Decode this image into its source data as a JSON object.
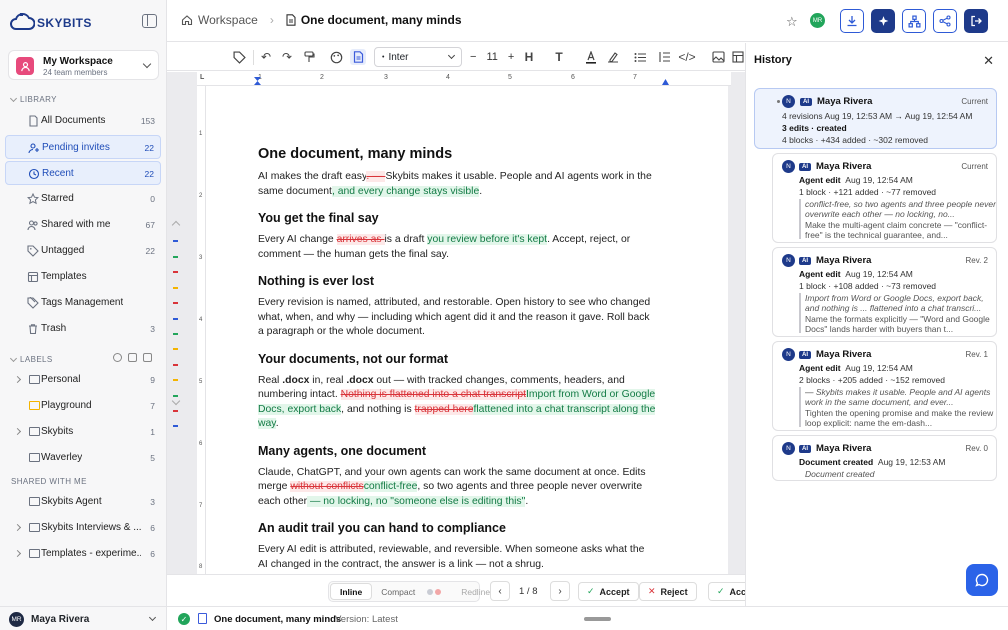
{
  "brand": {
    "name": "SKYBITS"
  },
  "workspace": {
    "name": "My Workspace",
    "members": "24 team members"
  },
  "sidebar": {
    "library_label": "LIBRARY",
    "library": [
      {
        "label": "All Documents",
        "count": "153"
      },
      {
        "label": "Pending invites",
        "count": "22"
      },
      {
        "label": "Recent",
        "count": "22"
      },
      {
        "label": "Starred",
        "count": "0"
      },
      {
        "label": "Shared with me",
        "count": "67"
      },
      {
        "label": "Untagged",
        "count": "22"
      },
      {
        "label": "Templates",
        "count": ""
      },
      {
        "label": "Tags Management",
        "count": ""
      },
      {
        "label": "Trash",
        "count": "3"
      }
    ],
    "labels_label": "LABELS",
    "labels": [
      {
        "label": "Personal",
        "count": "9"
      },
      {
        "label": "Playground",
        "count": "7"
      },
      {
        "label": "Skybits",
        "count": "1"
      },
      {
        "label": "Waverley",
        "count": "5"
      }
    ],
    "shared_label": "SHARED WITH ME",
    "shared": [
      {
        "label": "Skybits Agent",
        "count": "3"
      },
      {
        "label": "Skybits Interviews & ...",
        "count": "6"
      },
      {
        "label": "Templates - experime...",
        "count": "6"
      }
    ]
  },
  "user": {
    "initials": "MR",
    "name": "Maya Rivera"
  },
  "header": {
    "crumb": "Workspace",
    "title": "One document, many minds",
    "avatar": "MR"
  },
  "toolbar": {
    "font": "Inter",
    "size": "11"
  },
  "ruler": {
    "marks": [
      "L",
      "1",
      "2",
      "3",
      "4",
      "5",
      "6",
      "7"
    ],
    "vmarks": [
      "1",
      "2",
      "3",
      "4",
      "5",
      "6",
      "7",
      "8"
    ]
  },
  "document": {
    "title": "One document, many minds",
    "intro": {
      "a": "AI makes the draft easy",
      "b": ". — ",
      "c": "Skybits makes it usable. People and AI agents work in the same document",
      "d": ", and every change stays visible",
      "e": "."
    },
    "h1": "You get the final say",
    "p1": {
      "a": "Every AI change ",
      "b": "arrives as ",
      "c": "is a draft ",
      "d": "you review before it's kept",
      "e": ". Accept, reject, or comment — the human gets the final say."
    },
    "h2": "Nothing is ever lost",
    "p2": "Every revision is named, attributed, and restorable. Open history to see who changed what, when, and why — including which agent did it and the reason it gave. Roll back a paragraph or the whole document.",
    "h3": "Your documents, not our format",
    "p3": {
      "a": "Real ",
      "b": ".docx",
      "c": " in, real ",
      "d": ".docx",
      "e": " out — with tracked changes, comments, headers, and numbering intact. ",
      "f": "Nothing is flattened into a chat transcript",
      "g": "Import from Word or Google Docs, export back",
      "h": ", and nothing is ",
      "i": "trapped here",
      "j": "flattened into a chat transcript along the way",
      "k": "."
    },
    "h4": "Many agents, one document",
    "p4": {
      "a": "Claude, ChatGPT, and your own agents can work the same document at once. Edits merge ",
      "b": "without conflicts",
      "c": "conflict-free",
      "d": ", so two agents and three people never overwrite each other",
      "e": " — no locking, no \"someone else is editing this\"",
      "f": "."
    },
    "h5": "An audit trail you can hand to compliance",
    "p5": "Every AI edit is attributed, reviewable, and reversible. When someone asks what the AI changed in the contract, the answer is a link — not a shrug."
  },
  "review": {
    "modes": [
      "Inline",
      "Compact",
      "Redline"
    ],
    "page": "1 / 8",
    "accept": "Accept",
    "reject": "Reject",
    "accept_all": "Accept all"
  },
  "status": {
    "doc": "One document, many minds",
    "version": "Version: Latest"
  },
  "history": {
    "title": "History",
    "entries": [
      {
        "avatar": "N",
        "ai": "AI",
        "name": "Maya Rivera",
        "tag": "Current",
        "line1": "4 revisions  Aug 19, 12:53 AM → Aug 19, 12:54 AM",
        "line2": "3 edits · created",
        "line3": "4 blocks · +434 added · ~302 removed"
      },
      {
        "avatar": "N",
        "ai": "AI",
        "name": "Maya Rivera",
        "tag": "Current",
        "kind": "Agent edit",
        "time": "Aug 19, 12:54 AM",
        "stats": "1 block · +121 added · ~77 removed",
        "quote": "conflict-free, so two agents and three people never overwrite each other — no locking, no...",
        "reason": "Make the multi-agent claim concrete — \"conflict-free\" is the technical guarantee, and..."
      },
      {
        "avatar": "N",
        "ai": "AI",
        "name": "Maya Rivera",
        "tag": "Rev. 2",
        "kind": "Agent edit",
        "time": "Aug 19, 12:54 AM",
        "stats": "1 block · +108 added · ~73 removed",
        "quote": "Import from Word or Google Docs, export back, and nothing is ... flattened into a chat transcri...",
        "reason": "Name the formats explicitly — \"Word and Google Docs\" lands harder with buyers than t..."
      },
      {
        "avatar": "N",
        "ai": "AI",
        "name": "Maya Rivera",
        "tag": "Rev. 1",
        "kind": "Agent edit",
        "time": "Aug 19, 12:54 AM",
        "stats": "2 blocks · +205 added · ~152 removed",
        "quote": "— Skybits makes it usable. People and AI agents work in the same document, and ever...",
        "reason": "Tighten the opening promise and make the review loop explicit: name the em-dash..."
      },
      {
        "avatar": "N",
        "ai": "AI",
        "name": "Maya Rivera",
        "tag": "Rev. 0",
        "kind": "Document created",
        "time": "Aug 19, 12:53 AM",
        "quote": "Document created"
      }
    ]
  },
  "colors": {
    "accent": "#2e5ad6",
    "insert": "#137b45",
    "delete": "#d9343a",
    "brand": "#1e3a8a"
  }
}
